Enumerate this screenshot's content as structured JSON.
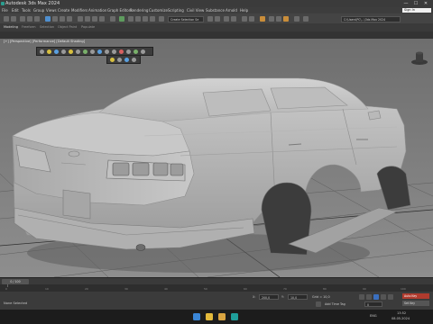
{
  "window": {
    "title": "Autodesk 3ds Max 2024",
    "controls": [
      "—",
      "☐",
      "✕"
    ]
  },
  "menu": {
    "items": [
      "File",
      "Edit",
      "Tools",
      "Group",
      "Views",
      "Create",
      "Modifiers",
      "Animation",
      "Graph Editors",
      "Rendering",
      "Customize",
      "Scripting",
      "Civil View",
      "Substance",
      "Arnold",
      "Help"
    ],
    "sign_in": "Sign In"
  },
  "toolbar": {
    "selection_set": "Create Selection Se",
    "workspace": "C:\\Users\\PC\\...\\3ds Max 2024"
  },
  "ribbon": {
    "tabs": [
      "Modeling",
      "Freeform",
      "Selection",
      "Object Paint",
      "Populate"
    ]
  },
  "viewport": {
    "label": "[+] [Perspective] [Performance] [Default Shading]"
  },
  "timeline": {
    "ticks": [
      "0",
      "10",
      "20",
      "30",
      "40",
      "50",
      "60",
      "70",
      "80",
      "90",
      "100"
    ],
    "position": "0 / 100"
  },
  "status": {
    "selection": "None Selected",
    "x_label": "X:",
    "x_value": "200,0",
    "y_label": "Y:",
    "y_value": "10,0",
    "grid": "Grid = 10,0",
    "add_time_tag": "Add Time Tag",
    "auto_key": "Auto Key",
    "set_key": "Set Key",
    "frame": "0",
    "selected": "Selected"
  },
  "taskbar": {
    "lang": "ENG",
    "time": "13:52",
    "date": "08.05.2024"
  },
  "colors": {
    "viewport_bg": "#8a8a8a",
    "car_body": "#b4b4b4",
    "auto_key": "#b03b2e"
  },
  "icons": {
    "app": "3dsmax-icon",
    "windows_start": "windows-start-icon",
    "chrome": "chrome-icon",
    "folder": "file-explorer-icon",
    "max": "3dsmax-taskbar-icon"
  }
}
